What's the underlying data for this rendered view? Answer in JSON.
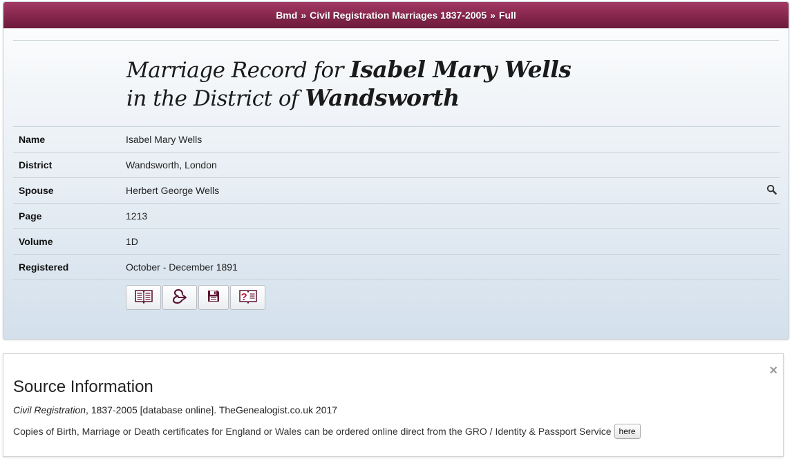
{
  "breadcrumb": {
    "items": [
      "Bmd",
      "Civil Registration Marriages 1837-2005",
      "Full"
    ],
    "separator": "»"
  },
  "heading": {
    "line1_prefix": "Marriage Record for",
    "line1_name": "Isabel Mary Wells",
    "line2_prefix": "in the District of",
    "line2_district": "Wandsworth"
  },
  "record": {
    "rows": [
      {
        "label": "Name",
        "value": "Isabel Mary Wells"
      },
      {
        "label": "District",
        "value": "Wandsworth, London"
      },
      {
        "label": "Spouse",
        "value": "Herbert George Wells",
        "action_icon": "search-icon"
      },
      {
        "label": "Page",
        "value": "1213"
      },
      {
        "label": "Volume",
        "value": "1D"
      },
      {
        "label": "Registered",
        "value": "October - December 1891"
      }
    ]
  },
  "toolbar": {
    "buttons": [
      {
        "icon": "book-icon"
      },
      {
        "icon": "share-icon"
      },
      {
        "icon": "save-icon"
      },
      {
        "icon": "help-icon"
      }
    ]
  },
  "source": {
    "close_symbol": "×",
    "title": "Source Information",
    "citation_italic": "Civil Registration",
    "citation_rest": ", 1837-2005 [database online]. TheGenealogist.co.uk 2017",
    "order_text": "Copies of Birth, Marriage or Death certificates for England or Wales can be ordered online direct from the GRO / Identity & Passport Service",
    "here_label": "here"
  },
  "colors": {
    "header_bar": "#8b2950",
    "icon_maroon": "#6b1a3a"
  }
}
